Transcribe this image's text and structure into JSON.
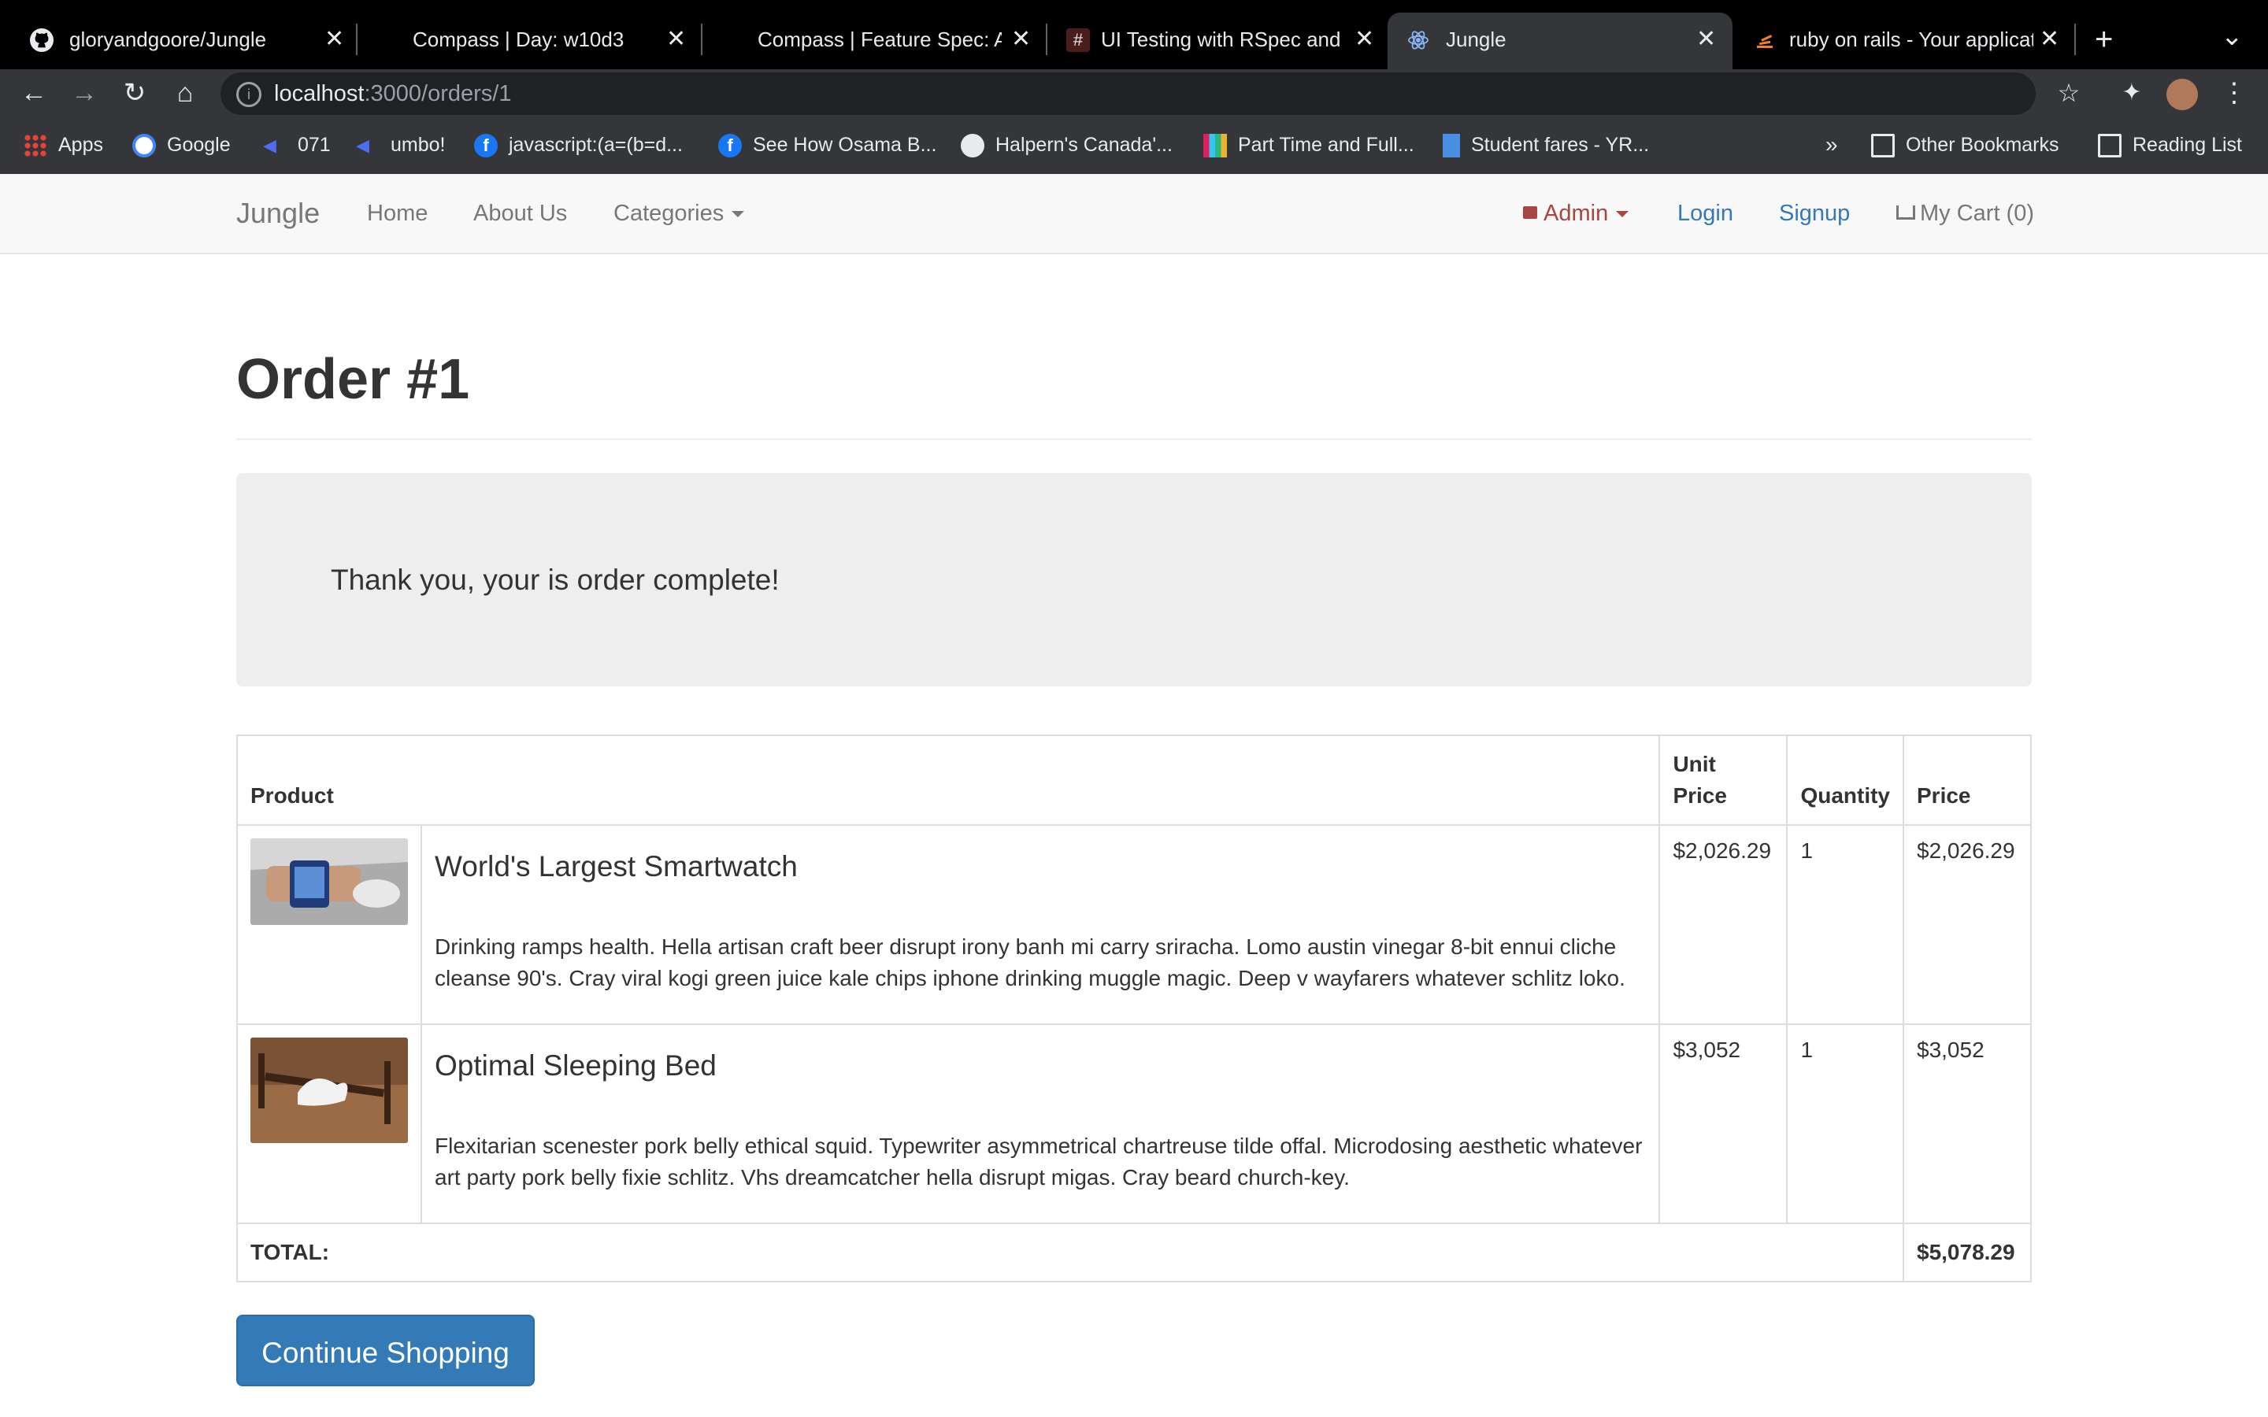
{
  "browser": {
    "tabs": [
      {
        "title": "gloryandgoore/Jungle",
        "icon": "github-icon",
        "active": false
      },
      {
        "title": "Compass | Day: w10d3",
        "icon": "compass-icon",
        "active": false
      },
      {
        "title": "Compass | Feature Spec: A",
        "icon": "compass-icon",
        "active": false
      },
      {
        "title": "UI Testing with RSpec and C",
        "icon": "hashtag-icon",
        "active": false
      },
      {
        "title": "Jungle",
        "icon": "react-icon",
        "active": true
      },
      {
        "title": "ruby on rails - Your applicat",
        "icon": "stackoverflow-icon",
        "active": false
      }
    ],
    "close_glyph": "✕",
    "new_tab_glyph": "+",
    "tab_menu_glyph": "⌄",
    "url_host": "localhost",
    "url_rest": ":3000/orders/1",
    "bookmarks": [
      {
        "label": "Apps",
        "icon": "apps-grid-icon"
      },
      {
        "label": "Google",
        "icon": "google-icon"
      },
      {
        "label": "071",
        "icon": "arrow-icon"
      },
      {
        "label": "umbo!",
        "icon": "arrow-icon"
      },
      {
        "label": "javascript:(a=(b=d...",
        "icon": "facebook-icon"
      },
      {
        "label": "See How Osama B...",
        "icon": "facebook-icon"
      },
      {
        "label": "Halpern's Canada'...",
        "icon": "globe-icon"
      },
      {
        "label": "Part Time and Full...",
        "icon": "slack-icon"
      },
      {
        "label": "Student fares - YR...",
        "icon": "bookmark-icon"
      }
    ],
    "more_bookmarks": "»",
    "other_bookmarks": "Other Bookmarks",
    "reading_list": "Reading List"
  },
  "navbar": {
    "brand": "Jungle",
    "home": "Home",
    "about": "About Us",
    "categories": "Categories",
    "admin": "Admin",
    "login": "Login",
    "signup": "Signup",
    "cart": "My Cart (0)"
  },
  "page": {
    "title": "Order #1",
    "message": "Thank you, your is order complete!"
  },
  "table": {
    "headers": {
      "product": "Product",
      "unit_price_line1": "Unit",
      "unit_price_line2": "Price",
      "quantity": "Quantity",
      "price": "Price"
    },
    "rows": [
      {
        "name": "World's Largest Smartwatch",
        "description": "Drinking ramps health. Hella artisan craft beer disrupt irony banh mi carry sriracha. Lomo austin vinegar 8-bit ennui cliche cleanse 90's. Cray viral kogi green juice kale chips iphone drinking muggle magic. Deep v wayfarers whatever schlitz loko.",
        "unit_price": "$2,026.29",
        "quantity": "1",
        "price": "$2,026.29"
      },
      {
        "name": "Optimal Sleeping Bed",
        "description": "Flexitarian scenester pork belly ethical squid. Typewriter asymmetrical chartreuse tilde offal. Microdosing aesthetic whatever art party pork belly fixie schlitz. Vhs dreamcatcher hella disrupt migas. Cray beard church-key.",
        "unit_price": "$3,052",
        "quantity": "1",
        "price": "$3,052"
      }
    ],
    "total_label": "TOTAL:",
    "total_value": "$5,078.29"
  },
  "continue_button": "Continue Shopping",
  "colors": {
    "link": "#337ab7",
    "admin": "#a94442",
    "button": "#337ab7"
  }
}
